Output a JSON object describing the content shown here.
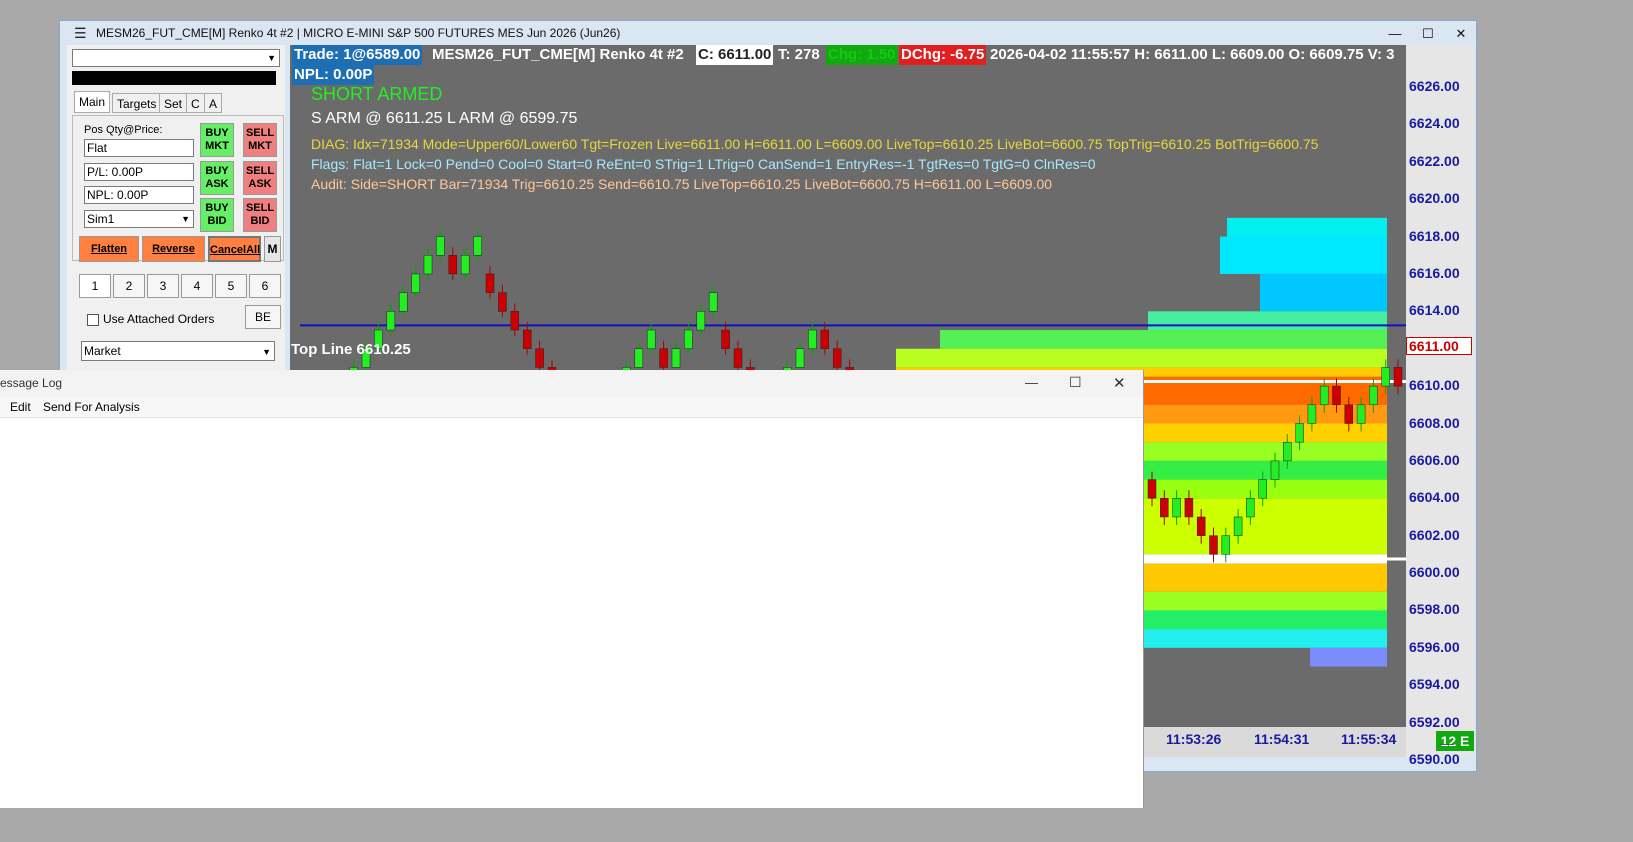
{
  "window": {
    "menu_icon": "hamburger-icon",
    "title": "MESM26_FUT_CME[M]  Renko 4t #2 | MICRO E-MINI S&P 500 FUTURES MES Jun 2026 (Jun26)",
    "minimize": "—",
    "maximize": "☐",
    "close": "✕"
  },
  "panel": {
    "account_dropdown": "",
    "tabs": [
      "Main",
      "Targets",
      "Set",
      "C",
      "A"
    ],
    "pos_label": "Pos Qty@Price:",
    "pos_value": "Flat",
    "pl_value": "P/L: 0.00P",
    "npl_value": "NPL: 0.00P",
    "account": "Sim1",
    "buttons": {
      "buy_mkt": "BUY MKT",
      "sell_mkt": "SELL MKT",
      "buy_ask": "BUY ASK",
      "sell_ask": "SELL ASK",
      "buy_bid": "BUY BID",
      "sell_bid": "SELL BID"
    },
    "flatten": "Flatten",
    "reverse": "Reverse",
    "cancel_all": "CancelAll",
    "m": "M",
    "qty_buttons": [
      "1",
      "2",
      "3",
      "4",
      "5",
      "6"
    ],
    "attached_orders": "Use Attached Orders",
    "be": "BE",
    "order_type": "Market",
    "colors": {
      "buy": "#66ee66",
      "sell": "#f08080",
      "action": "#ff8040"
    }
  },
  "chart": {
    "trade": "Trade: 1@6589.00",
    "instrument": "MESM26_FUT_CME[M]  Renko 4t #2",
    "close": "C: 6611.00",
    "ticks": "T: 278",
    "chg": "Chg: 1.50",
    "dchg": "DChg: -6.75",
    "rest": "2026-04-02 11:55:57 H: 6611.00 L: 6609.00 O: 6609.75 V: 3",
    "npl": "NPL: 0.00P",
    "status": "SHORT ARMED",
    "arm": "S ARM @ 6611.25   L ARM @ 6599.75",
    "diag": "DIAG: Idx=71934 Mode=Upper60/Lower60 Tgt=Frozen Live=6611.00 H=6611.00 L=6609.00 LiveTop=6610.25 LiveBot=6600.75 TopTrig=6610.25 BotTrig=6600.75",
    "flags": "Flags: Flat=1 Lock=0 Pend=0 Cool=0 Start=0 ReEnt=0 STrig=1 LTrig=0 CanSend=1 EntryRes=-1 TgtRes=0 TgtG=0 ClnRes=0",
    "audit": "Audit: Side=SHORT Bar=71934 Trig=6610.25 Send=6610.75 LiveTop=6610.25 LiveBot=6600.75 H=6611.00 L=6609.00",
    "top_line": "Top Line  6610.25",
    "price_tag": "6611.00",
    "y_ticks": [
      "6626.00",
      "6624.00",
      "6622.00",
      "6620.00",
      "6618.00",
      "6616.00",
      "6614.00",
      "6612.00",
      "6610.00",
      "6608.00",
      "6606.00",
      "6604.00",
      "6602.00",
      "6600.00",
      "6598.00",
      "6596.00",
      "6594.00",
      "6592.00",
      "6590.00"
    ],
    "x_ticks": [
      "11:53:26",
      "11:54:31",
      "11:55:34"
    ],
    "badge": "12 E",
    "colors": {
      "status": "#22ee22",
      "diag": "#e5d83a",
      "flags": "#a8e8ff",
      "audit": "#ffc79a"
    }
  },
  "chart_data": {
    "type": "candlestick",
    "ylim": [
      6589,
      6627
    ],
    "price": 6611.0,
    "top_line": 6610.25,
    "bottom_line": 6600.75,
    "blue_line": 6613.25
  },
  "msglog": {
    "title": "essage Log",
    "menu": [
      "Edit",
      "Send For Analysis"
    ],
    "minimize": "—",
    "maximize": "☐",
    "close": "✕"
  }
}
